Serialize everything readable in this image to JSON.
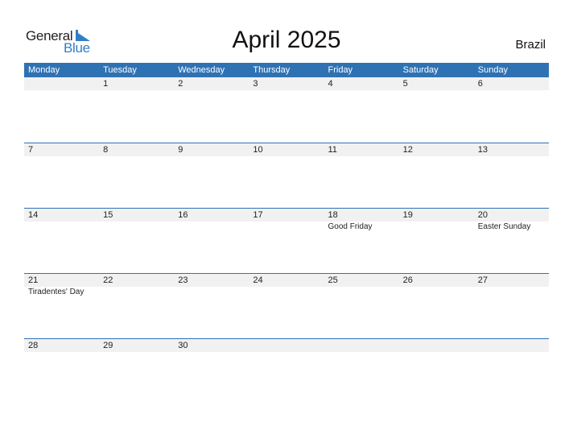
{
  "logo": {
    "line1": "General",
    "line2": "Blue"
  },
  "title": "April 2025",
  "country": "Brazil",
  "colors": {
    "header_bg": "#2f72b4",
    "accent": "#2f7fc8",
    "date_strip_bg": "#f1f1f1"
  },
  "weekdays": [
    "Monday",
    "Tuesday",
    "Wednesday",
    "Thursday",
    "Friday",
    "Saturday",
    "Sunday"
  ],
  "weeks": [
    {
      "days": [
        {
          "num": "",
          "holiday": ""
        },
        {
          "num": "1",
          "holiday": ""
        },
        {
          "num": "2",
          "holiday": ""
        },
        {
          "num": "3",
          "holiday": ""
        },
        {
          "num": "4",
          "holiday": ""
        },
        {
          "num": "5",
          "holiday": ""
        },
        {
          "num": "6",
          "holiday": ""
        }
      ]
    },
    {
      "days": [
        {
          "num": "7",
          "holiday": ""
        },
        {
          "num": "8",
          "holiday": ""
        },
        {
          "num": "9",
          "holiday": ""
        },
        {
          "num": "10",
          "holiday": ""
        },
        {
          "num": "11",
          "holiday": ""
        },
        {
          "num": "12",
          "holiday": ""
        },
        {
          "num": "13",
          "holiday": ""
        }
      ]
    },
    {
      "days": [
        {
          "num": "14",
          "holiday": ""
        },
        {
          "num": "15",
          "holiday": ""
        },
        {
          "num": "16",
          "holiday": ""
        },
        {
          "num": "17",
          "holiday": ""
        },
        {
          "num": "18",
          "holiday": "Good Friday"
        },
        {
          "num": "19",
          "holiday": ""
        },
        {
          "num": "20",
          "holiday": "Easter Sunday"
        }
      ]
    },
    {
      "days": [
        {
          "num": "21",
          "holiday": "Tiradentes' Day"
        },
        {
          "num": "22",
          "holiday": ""
        },
        {
          "num": "23",
          "holiday": ""
        },
        {
          "num": "24",
          "holiday": ""
        },
        {
          "num": "25",
          "holiday": ""
        },
        {
          "num": "26",
          "holiday": ""
        },
        {
          "num": "27",
          "holiday": ""
        }
      ]
    },
    {
      "days": [
        {
          "num": "28",
          "holiday": ""
        },
        {
          "num": "29",
          "holiday": ""
        },
        {
          "num": "30",
          "holiday": ""
        },
        {
          "num": "",
          "holiday": ""
        },
        {
          "num": "",
          "holiday": ""
        },
        {
          "num": "",
          "holiday": ""
        },
        {
          "num": "",
          "holiday": ""
        }
      ]
    }
  ]
}
